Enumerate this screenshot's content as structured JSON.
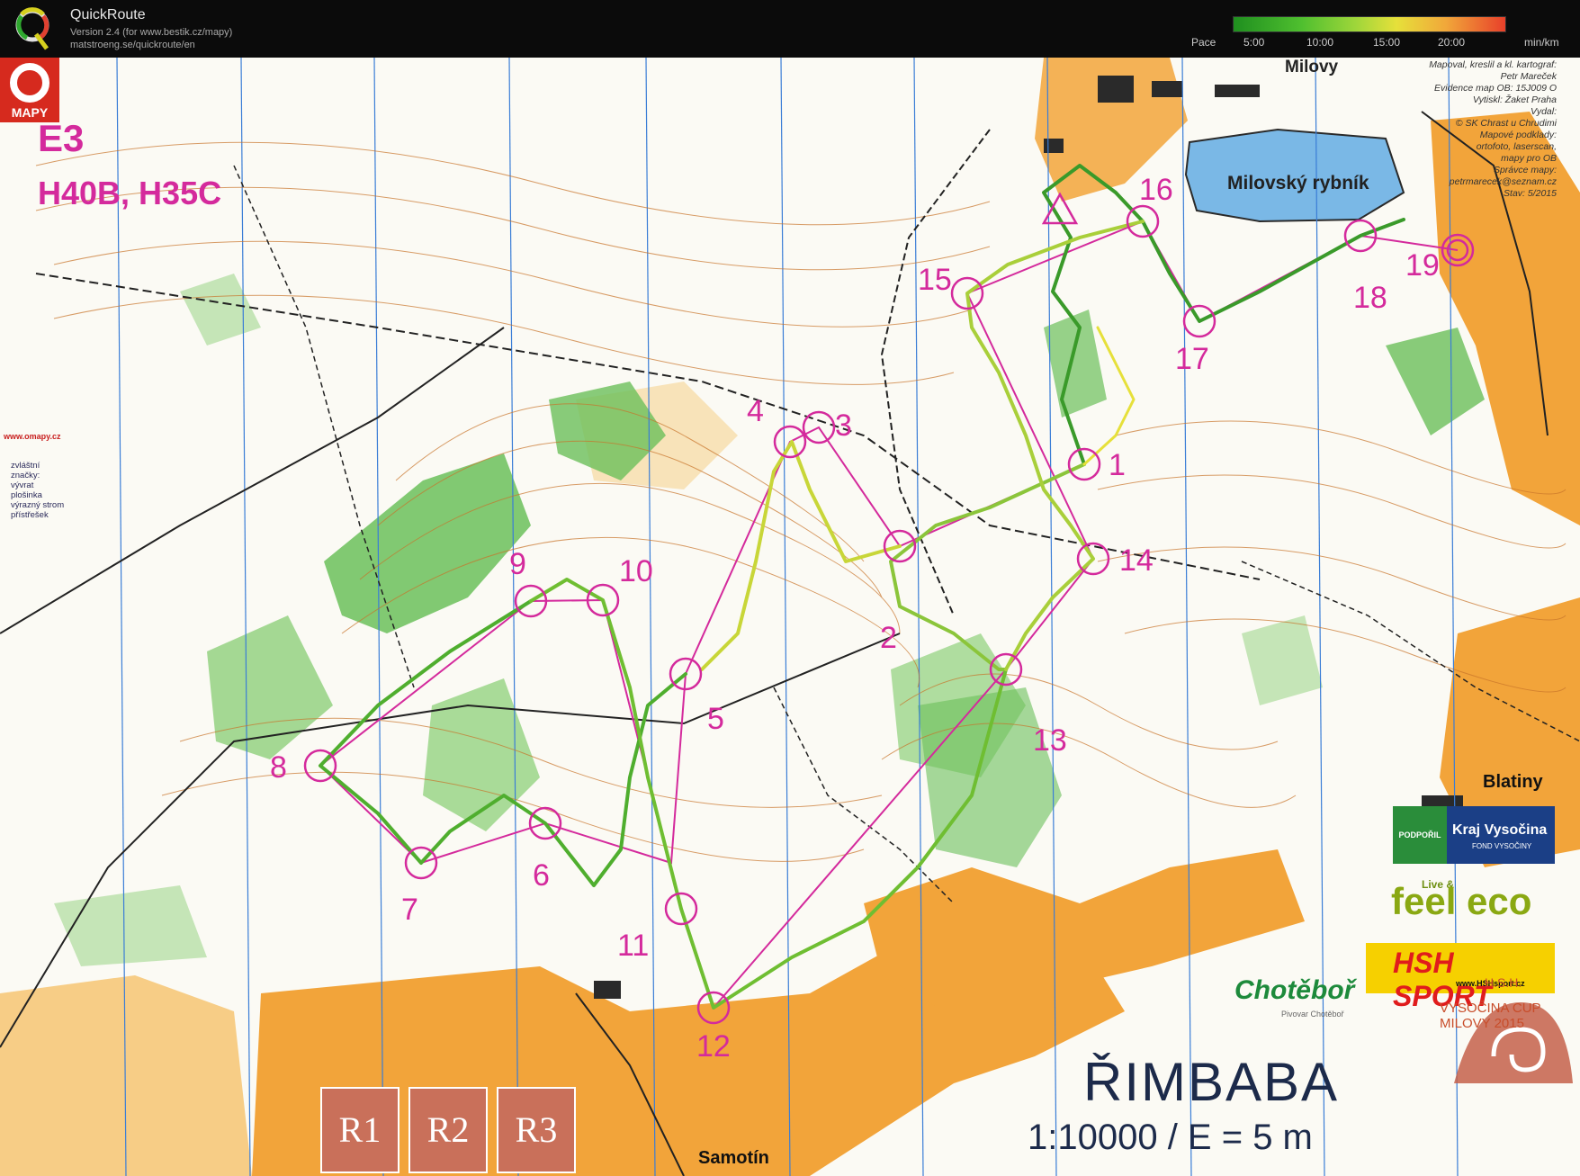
{
  "app": {
    "title": "QuickRoute",
    "version": "Version 2.4  (for www.bestik.cz/mapy)",
    "url": "matstroeng.se/quickroute/en"
  },
  "pace_scale": {
    "label": "Pace",
    "ticks": [
      "5:00",
      "10:00",
      "15:00",
      "20:00"
    ],
    "unit": "min/km",
    "colors": [
      "#1f8f1f",
      "#4fbf2f",
      "#9fd63a",
      "#e6e03a",
      "#f1a83a",
      "#e8402a"
    ]
  },
  "map": {
    "course": "E3",
    "classes": "H40B, H35C",
    "name": "ŘIMBABA",
    "scale": "1:10000 / E = 5 m",
    "places": {
      "pond": "Milovský rybník",
      "milovy": "Milovy",
      "blatiny": "Blatiny",
      "samotin": "Samotín"
    },
    "credits": [
      "Mapoval, kreslil a kl. kartograf:",
      "Petr Mareček",
      "Evidence map OB: 15J009 O",
      "Vytiskl: Žaket Praha",
      "Vydal:",
      "© SK Chrast u Chrudimi",
      "Mapové podklady:",
      "ortofoto, laserscan,",
      "mapy pro OB",
      "Správce mapy:",
      "petrmarecek@seznam.cz",
      "Stav: 5/2015"
    ],
    "legend": {
      "title": "zvláštní značky:",
      "items": [
        "vývrat",
        "plošinka",
        "výrazný strom",
        "přístřešek"
      ]
    },
    "omapy_url": "www.omapy.cz",
    "omapy_name": "MAPY",
    "boxes": [
      "R1",
      "R2",
      "R3"
    ],
    "controls": [
      "1",
      "2",
      "3",
      "4",
      "5",
      "6",
      "7",
      "8",
      "9",
      "10",
      "11",
      "12",
      "13",
      "14",
      "15",
      "16",
      "17",
      "18",
      "19"
    ]
  },
  "sponsors": {
    "kraj_left": "PODPOŘIL",
    "kraj_name": "Kraj Vysočina",
    "kraj_sub": "FOND VYSOČINY",
    "live": "Live &",
    "eco": "feel eco",
    "hsh": "HSH SPORT",
    "hsh_url": "www.HSHsport.cz",
    "chotebor": "Chotěboř",
    "chotebor_sub": "Pivovar Chotěboř",
    "cup_hsh": "H.S.H.",
    "cup": "VYSOČINA CUP MILOVY 2015"
  }
}
